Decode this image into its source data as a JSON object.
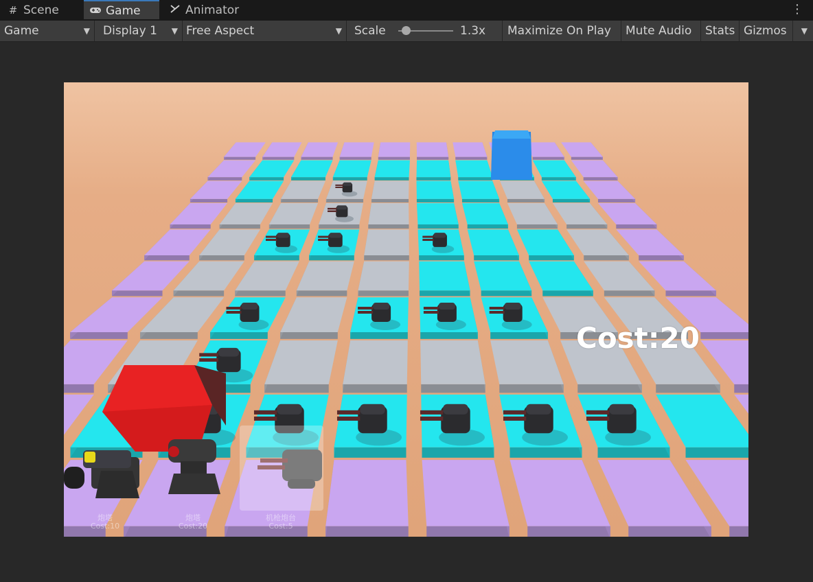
{
  "tabs": [
    {
      "label": "Scene",
      "icon": "grid-icon"
    },
    {
      "label": "Game",
      "icon": "gamepad-icon",
      "active": true
    },
    {
      "label": "Animator",
      "icon": "animator-icon"
    }
  ],
  "toolbar": {
    "game_view": "Game",
    "display": "Display 1",
    "aspect": "Free Aspect",
    "scale_label": "Scale",
    "scale_value": "1.3x",
    "maximize": "Maximize On Play",
    "mute": "Mute Audio",
    "stats": "Stats",
    "gizmos": "Gizmos"
  },
  "game": {
    "cost_label": "Cost:20",
    "cards": [
      {
        "name": "炮塔",
        "cost": "Cost:10"
      },
      {
        "name": "炮塔",
        "cost": "Cost:20"
      },
      {
        "name": "机枪炮台",
        "cost": "Cost:5"
      }
    ]
  },
  "colors": {
    "sky": "#e6a97f",
    "ground": "#e3a77c",
    "tile_purple": "#c9a6f0",
    "tile_cyan": "#24e6ee",
    "tile_gray": "#bfc4cc",
    "spawn_cube": "#e82223",
    "goal_cube": "#2d8fe8",
    "accent_tab": "#3a79bb"
  }
}
